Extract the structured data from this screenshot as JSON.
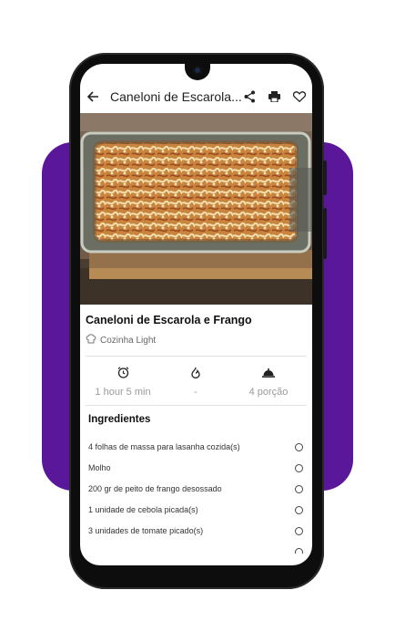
{
  "header": {
    "title": "Caneloni de Escarola...",
    "icons": [
      "back-arrow-icon",
      "share-icon",
      "print-icon",
      "heart-icon"
    ]
  },
  "recipe": {
    "name": "Caneloni de Escarola e Frango",
    "category": "Cozinha Light"
  },
  "stats": {
    "time": "1 hour 5 min",
    "difficulty": "-",
    "servings": "4 porção"
  },
  "ingredients": {
    "title": "Ingredientes",
    "items": [
      "4 folhas de massa para lasanha cozida(s)",
      "Molho",
      "200 gr de peito de frango desossado",
      "1 unidade de cebola picada(s)",
      "3 unidades de tomate picado(s)"
    ]
  },
  "colors": {
    "accent": "#5b179a",
    "phone": "#0d0d0d"
  }
}
